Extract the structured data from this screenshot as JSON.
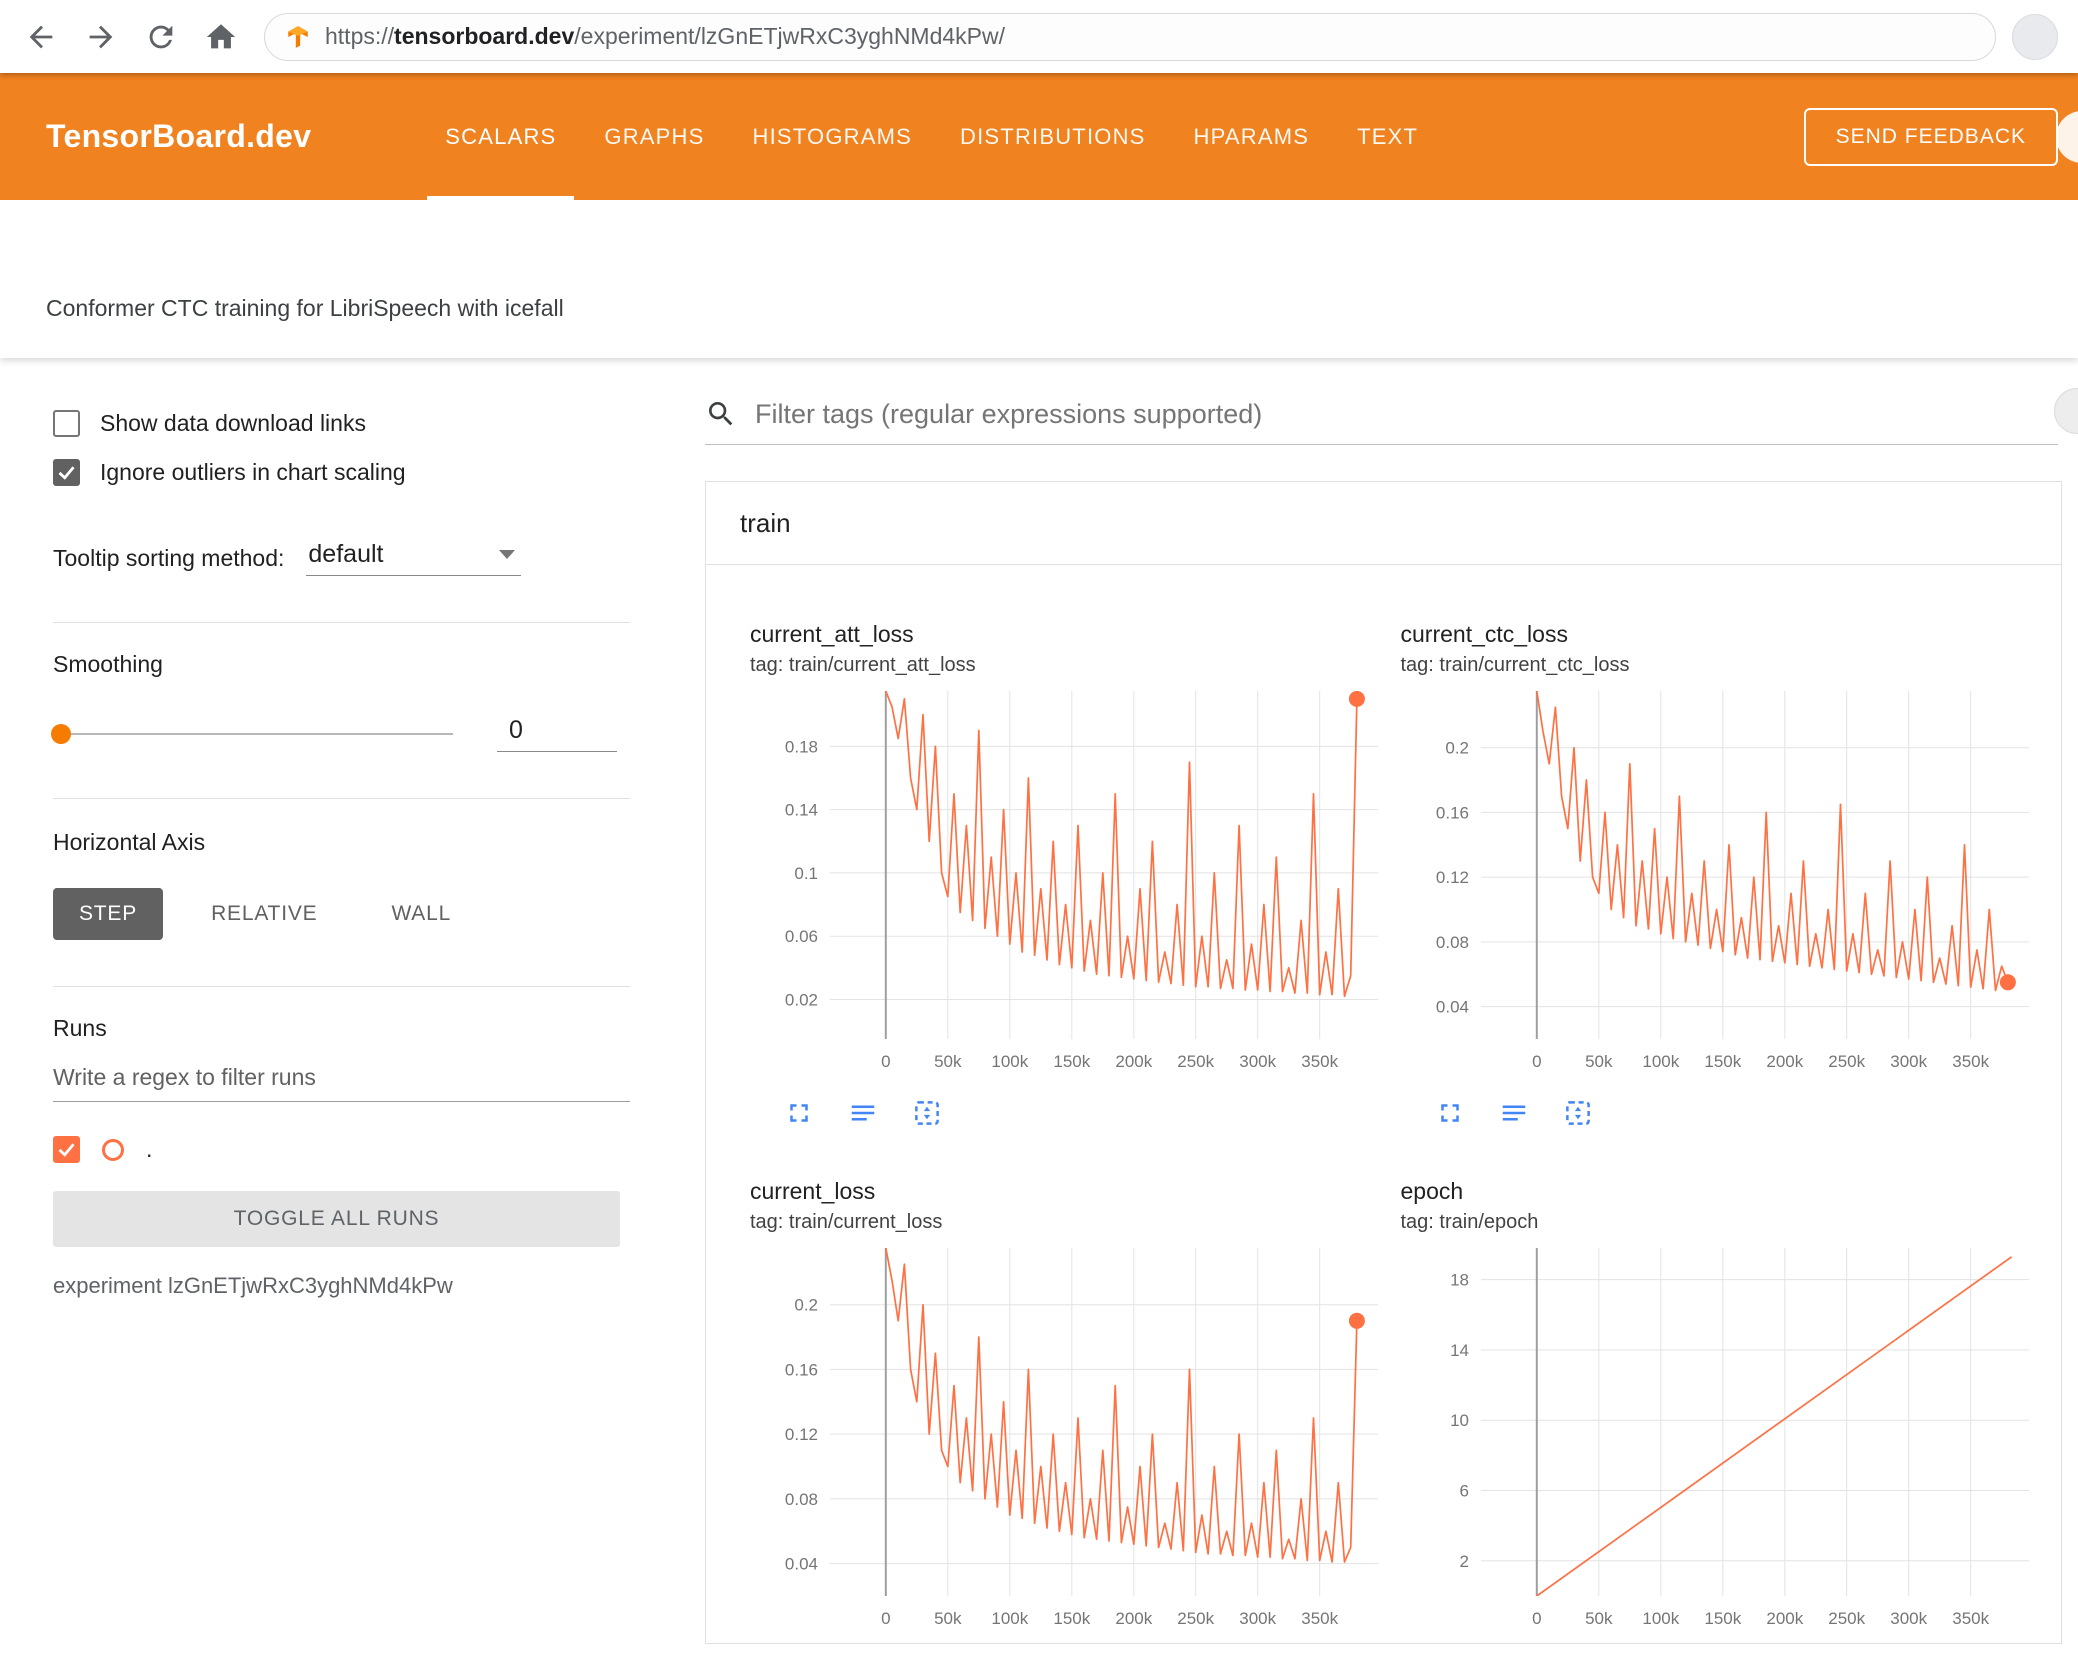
{
  "browser": {
    "url_scheme": "https://",
    "url_domain": "tensorboard.dev",
    "url_path": "/experiment/lzGnETjwRxC3yghNMd4kPw/"
  },
  "header": {
    "brand": "TensorBoard.dev",
    "tabs": [
      {
        "label": "SCALARS",
        "active": true
      },
      {
        "label": "GRAPHS",
        "active": false
      },
      {
        "label": "HISTOGRAMS",
        "active": false
      },
      {
        "label": "DISTRIBUTIONS",
        "active": false
      },
      {
        "label": "HPARAMS",
        "active": false
      },
      {
        "label": "TEXT",
        "active": false
      }
    ],
    "feedback_button": "SEND FEEDBACK"
  },
  "experiment_bar": {
    "title": "Conformer CTC training for LibriSpeech with icefall"
  },
  "sidebar": {
    "show_download": {
      "label": "Show data download links",
      "checked": false
    },
    "ignore_outliers": {
      "label": "Ignore outliers in chart scaling",
      "checked": true
    },
    "tooltip_sorting": {
      "label": "Tooltip sorting method:",
      "value": "default"
    },
    "smoothing": {
      "label": "Smoothing",
      "value": "0"
    },
    "horizontal_axis": {
      "label": "Horizontal Axis",
      "options": [
        "STEP",
        "RELATIVE",
        "WALL"
      ],
      "selected": "STEP"
    },
    "runs": {
      "label": "Runs",
      "filter_placeholder": "Write a regex to filter runs",
      "run": {
        "label": ".",
        "checked": true
      },
      "toggle_button": "TOGGLE ALL RUNS",
      "experiment_caption": "experiment lzGnETjwRxC3yghNMd4kPw"
    }
  },
  "main": {
    "filter_placeholder": "Filter tags (regular expressions supported)",
    "group_label": "train"
  },
  "colors": {
    "header_orange": "#f0821f",
    "run_color": "#ff7043",
    "slider_thumb": "#f57c00",
    "toolbar_icon_blue": "#4285f4"
  },
  "chart_data": [
    {
      "type": "line",
      "title": "current_att_loss",
      "subtitle": "tag: train/current_att_loss",
      "color": "#ff7043",
      "x_range": [
        -45000,
        397000
      ],
      "y_range": [
        -0.005,
        0.215
      ],
      "x_ticks": [
        0,
        50000,
        100000,
        150000,
        200000,
        250000,
        300000,
        350000
      ],
      "x_tick_labels": [
        "0",
        "50k",
        "100k",
        "150k",
        "200k",
        "250k",
        "300k",
        "350k"
      ],
      "y_ticks": [
        0.02,
        0.06,
        0.1,
        0.14,
        0.18
      ],
      "y_tick_labels": [
        "0.02",
        "0.06",
        "0.1",
        "0.14",
        "0.18"
      ],
      "x_start": 0,
      "x_step": 5000,
      "values": [
        0.215,
        0.205,
        0.185,
        0.21,
        0.16,
        0.14,
        0.2,
        0.12,
        0.18,
        0.1,
        0.085,
        0.15,
        0.075,
        0.13,
        0.07,
        0.19,
        0.065,
        0.11,
        0.06,
        0.14,
        0.055,
        0.1,
        0.05,
        0.16,
        0.048,
        0.09,
        0.045,
        0.12,
        0.042,
        0.08,
        0.04,
        0.13,
        0.038,
        0.07,
        0.036,
        0.1,
        0.035,
        0.15,
        0.034,
        0.06,
        0.033,
        0.09,
        0.032,
        0.12,
        0.031,
        0.05,
        0.03,
        0.08,
        0.029,
        0.17,
        0.028,
        0.06,
        0.028,
        0.1,
        0.027,
        0.045,
        0.027,
        0.13,
        0.026,
        0.055,
        0.026,
        0.08,
        0.025,
        0.11,
        0.025,
        0.04,
        0.024,
        0.07,
        0.024,
        0.15,
        0.023,
        0.05,
        0.023,
        0.09,
        0.022,
        0.035,
        0.21
      ],
      "end_marker": [
        380000,
        0.21
      ]
    },
    {
      "type": "line",
      "title": "current_ctc_loss",
      "subtitle": "tag: train/current_ctc_loss",
      "color": "#ff7043",
      "x_range": [
        -45000,
        397000
      ],
      "y_range": [
        0.02,
        0.235
      ],
      "x_ticks": [
        0,
        50000,
        100000,
        150000,
        200000,
        250000,
        300000,
        350000
      ],
      "x_tick_labels": [
        "0",
        "50k",
        "100k",
        "150k",
        "200k",
        "250k",
        "300k",
        "350k"
      ],
      "y_ticks": [
        0.04,
        0.08,
        0.12,
        0.16,
        0.2
      ],
      "y_tick_labels": [
        "0.04",
        "0.08",
        "0.12",
        "0.16",
        "0.2"
      ],
      "x_start": 0,
      "x_step": 5000,
      "values": [
        0.235,
        0.21,
        0.19,
        0.225,
        0.17,
        0.15,
        0.2,
        0.13,
        0.18,
        0.12,
        0.11,
        0.16,
        0.1,
        0.14,
        0.095,
        0.19,
        0.09,
        0.13,
        0.088,
        0.15,
        0.085,
        0.12,
        0.082,
        0.17,
        0.08,
        0.11,
        0.078,
        0.13,
        0.076,
        0.1,
        0.074,
        0.14,
        0.072,
        0.095,
        0.07,
        0.12,
        0.069,
        0.16,
        0.068,
        0.09,
        0.067,
        0.11,
        0.066,
        0.13,
        0.065,
        0.085,
        0.064,
        0.1,
        0.063,
        0.165,
        0.062,
        0.085,
        0.061,
        0.11,
        0.06,
        0.075,
        0.059,
        0.13,
        0.058,
        0.08,
        0.057,
        0.1,
        0.056,
        0.12,
        0.055,
        0.07,
        0.054,
        0.09,
        0.053,
        0.14,
        0.052,
        0.075,
        0.051,
        0.1,
        0.05,
        0.065,
        0.055
      ],
      "end_marker": [
        380000,
        0.055
      ]
    },
    {
      "type": "line",
      "title": "current_loss",
      "subtitle": "tag: train/current_loss",
      "color": "#ff7043",
      "x_range": [
        -45000,
        397000
      ],
      "y_range": [
        0.02,
        0.235
      ],
      "x_ticks": [
        0,
        50000,
        100000,
        150000,
        200000,
        250000,
        300000,
        350000
      ],
      "x_tick_labels": [
        "0",
        "50k",
        "100k",
        "150k",
        "200k",
        "250k",
        "300k",
        "350k"
      ],
      "y_ticks": [
        0.04,
        0.08,
        0.12,
        0.16,
        0.2
      ],
      "y_tick_labels": [
        "0.04",
        "0.08",
        "0.12",
        "0.16",
        "0.2"
      ],
      "x_start": 0,
      "x_step": 5000,
      "values": [
        0.235,
        0.215,
        0.19,
        0.225,
        0.16,
        0.14,
        0.2,
        0.12,
        0.17,
        0.11,
        0.1,
        0.15,
        0.09,
        0.13,
        0.085,
        0.18,
        0.08,
        0.12,
        0.075,
        0.14,
        0.07,
        0.11,
        0.068,
        0.16,
        0.065,
        0.1,
        0.062,
        0.12,
        0.06,
        0.09,
        0.058,
        0.13,
        0.056,
        0.08,
        0.055,
        0.11,
        0.054,
        0.15,
        0.053,
        0.075,
        0.052,
        0.1,
        0.051,
        0.12,
        0.05,
        0.065,
        0.049,
        0.09,
        0.048,
        0.16,
        0.047,
        0.07,
        0.046,
        0.1,
        0.046,
        0.06,
        0.045,
        0.12,
        0.045,
        0.065,
        0.044,
        0.09,
        0.044,
        0.11,
        0.043,
        0.055,
        0.043,
        0.08,
        0.042,
        0.13,
        0.042,
        0.06,
        0.041,
        0.09,
        0.041,
        0.05,
        0.19
      ],
      "end_marker": [
        380000,
        0.19
      ]
    },
    {
      "type": "line",
      "title": "epoch",
      "subtitle": "tag: train/epoch",
      "color": "#ff7043",
      "x_range": [
        -45000,
        397000
      ],
      "y_range": [
        0,
        19.8
      ],
      "x_ticks": [
        0,
        50000,
        100000,
        150000,
        200000,
        250000,
        300000,
        350000
      ],
      "x_tick_labels": [
        "0",
        "50k",
        "100k",
        "150k",
        "200k",
        "250k",
        "300k",
        "350k"
      ],
      "y_ticks": [
        2,
        6,
        10,
        14,
        18
      ],
      "y_tick_labels": [
        "2",
        "6",
        "10",
        "14",
        "18"
      ],
      "points": [
        [
          0,
          0
        ],
        [
          383000,
          19.3
        ]
      ]
    }
  ]
}
